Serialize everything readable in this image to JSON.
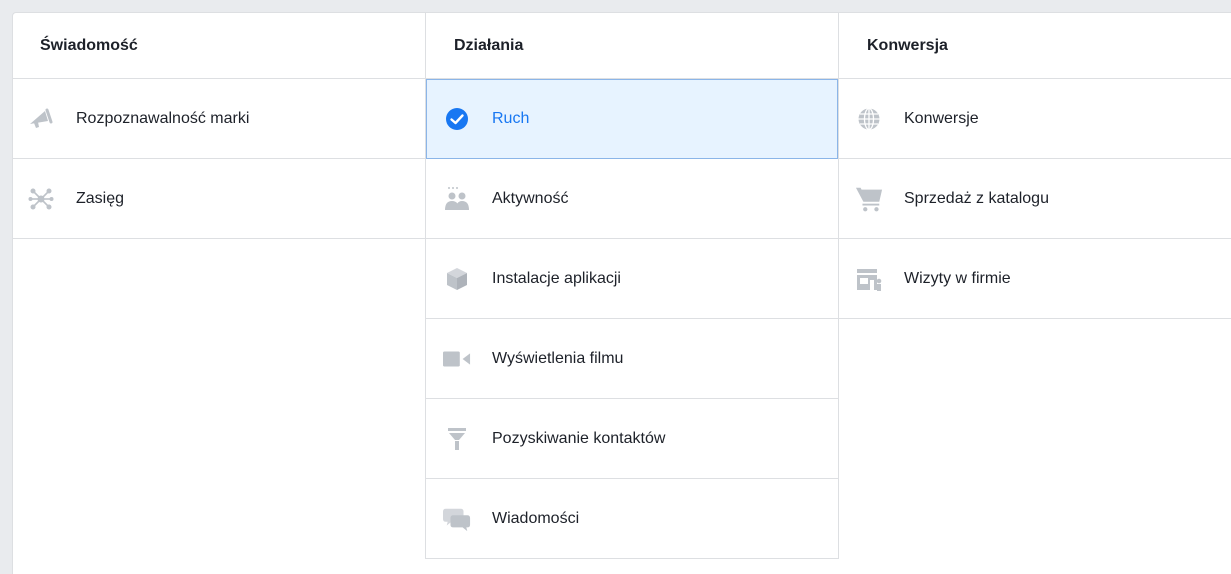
{
  "columns": [
    {
      "header": "Świadomość",
      "items": [
        {
          "label": "Rozpoznawalność marki",
          "icon": "megaphone-icon"
        },
        {
          "label": "Zasięg",
          "icon": "reach-network-icon"
        }
      ]
    },
    {
      "header": "Działania",
      "items": [
        {
          "label": "Ruch",
          "icon": "check-circle-icon",
          "selected": true
        },
        {
          "label": "Aktywność",
          "icon": "people-icon"
        },
        {
          "label": "Instalacje aplikacji",
          "icon": "app-box-icon"
        },
        {
          "label": "Wyświetlenia filmu",
          "icon": "video-camera-icon"
        },
        {
          "label": "Pozyskiwanie kontaktów",
          "icon": "funnel-icon"
        },
        {
          "label": "Wiadomości",
          "icon": "chat-bubbles-icon"
        }
      ]
    },
    {
      "header": "Konwersja",
      "items": [
        {
          "label": "Konwersje",
          "icon": "globe-icon"
        },
        {
          "label": "Sprzedaż z katalogu",
          "icon": "shopping-cart-icon"
        },
        {
          "label": "Wizyty w firmie",
          "icon": "storefront-icon"
        }
      ]
    }
  ],
  "colors": {
    "selected_bg": "#e7f3ff",
    "selected_text": "#1877f2",
    "icon_gray": "#bec3c9"
  }
}
